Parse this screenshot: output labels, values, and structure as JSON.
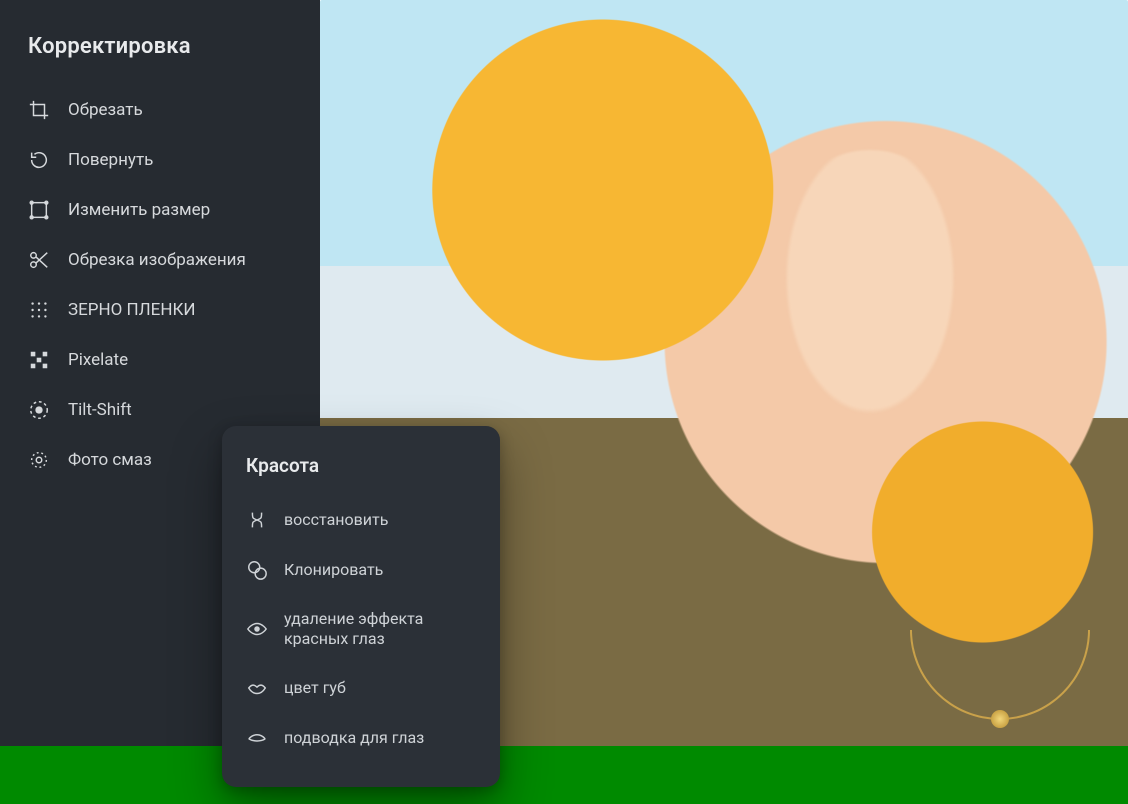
{
  "adjust_panel": {
    "title": "Корректировка",
    "items": [
      {
        "label": "Обрезать",
        "icon": "crop-icon"
      },
      {
        "label": "Повернуть",
        "icon": "rotate-icon"
      },
      {
        "label": "Изменить размер",
        "icon": "resize-icon"
      },
      {
        "label": "Обрезка изображения",
        "icon": "cut-icon"
      },
      {
        "label": "ЗЕРНО ПЛЕНКИ",
        "icon": "grain-icon"
      },
      {
        "label": "Pixelate",
        "icon": "pixelate-icon"
      },
      {
        "label": "Tilt-Shift",
        "icon": "tiltshift-icon"
      },
      {
        "label": "Фото смаз",
        "icon": "blur-icon"
      }
    ]
  },
  "beauty_panel": {
    "title": "Красота",
    "items": [
      {
        "label": "восстановить",
        "icon": "heal-icon"
      },
      {
        "label": "Клонировать",
        "icon": "clone-icon"
      },
      {
        "label": "удаление эффекта красных глаз",
        "icon": "redeye-icon"
      },
      {
        "label": "цвет губ",
        "icon": "lips-icon"
      },
      {
        "label": "подводка для глаз",
        "icon": "eyeliner-icon"
      }
    ]
  },
  "colors": {
    "panel_bg": "#262b31",
    "popup_bg": "#2b3037",
    "text": "#e8eaec",
    "accent_green": "#008a00"
  }
}
